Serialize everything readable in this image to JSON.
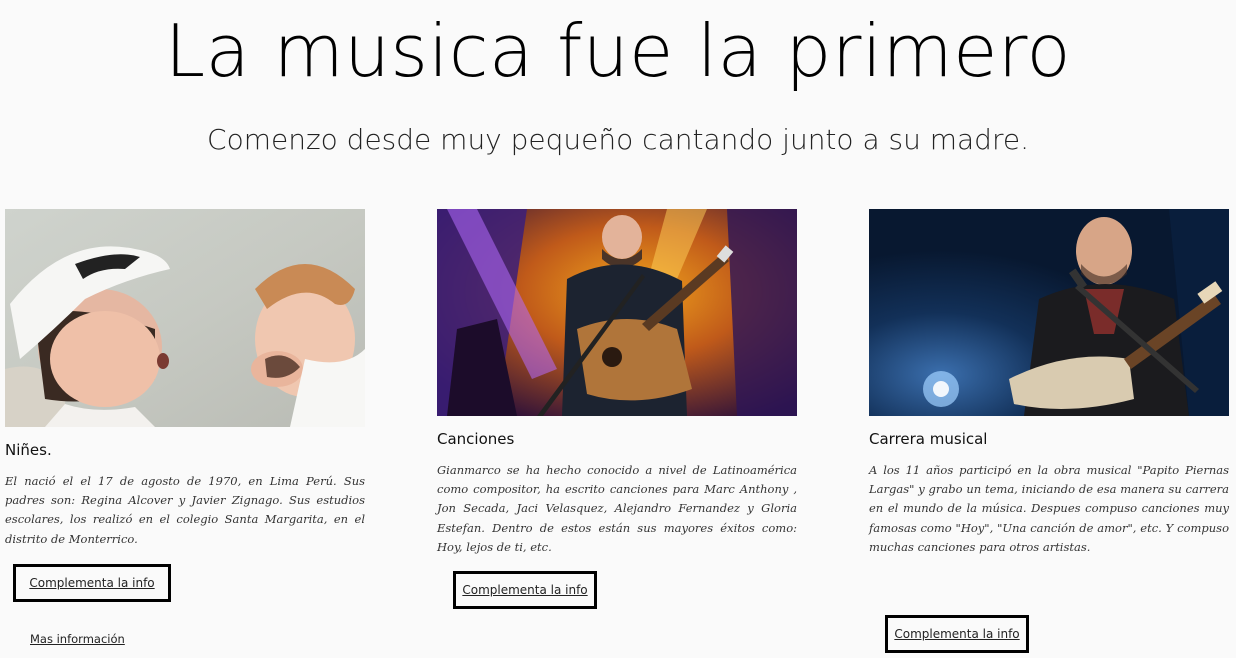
{
  "header": {
    "title": "La musica fue la primero",
    "subtitle": "Comenzo desde muy pequeño cantando junto a su madre."
  },
  "cards": [
    {
      "title": "Niñes.",
      "text": "El nació el el 17 de agosto de 1970, en Lima Perú. Sus padres son: Regina Alcover y Javier Zignago. Sus estudios escolares, los realizó en el colegio Santa Margarita, en el distrito de Monterrico.",
      "button": "Complementa la info",
      "image": "mother-and-baby-photo"
    },
    {
      "title": "Canciones",
      "text": "Gianmarco se ha hecho conocido a nivel de Latinoamérica como compositor, ha escrito canciones para Marc Anthony , Jon Secada, Jaci Velasquez, Alejandro Fernandez y Gloria Estefan. Dentro de estos están sus mayores éxitos como: Hoy, lejos de ti, etc.",
      "button": "Complementa la info",
      "image": "guitarist-on-stage-photo"
    },
    {
      "title": "Carrera musical",
      "text": "A los 11 años participó en la obra musical \"Papito Piernas Largas\" y grabo un tema, iniciando de esa manera su carrera en el mundo de la música. Despues compuso canciones muy famosas como \"Hoy\", \"Una canción de amor\", etc. Y compuso muchas canciones para otros artistas.",
      "button": "Complementa la info",
      "image": "singer-with-cuatro-photo"
    }
  ],
  "footer": {
    "more_link": "Mas información"
  }
}
